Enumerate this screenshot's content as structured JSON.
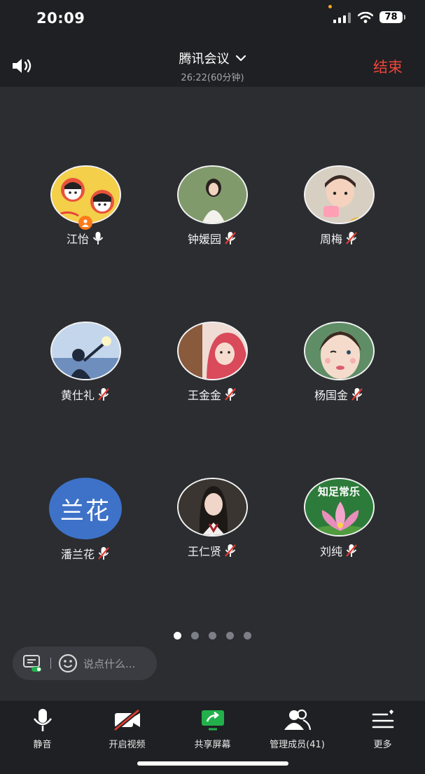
{
  "status_bar": {
    "time": "20:09",
    "battery": "78"
  },
  "header": {
    "title": "腾讯会议",
    "subtitle": "26:22(60分钟)",
    "end_label": "结束"
  },
  "participants": [
    {
      "name": "江怡",
      "mic": "mic-on",
      "host": true,
      "avatar": "cartoon"
    },
    {
      "name": "钟媛园",
      "mic": "mic-off",
      "avatar": "photo"
    },
    {
      "name": "周梅",
      "mic": "mic-off",
      "avatar": "photo"
    },
    {
      "name": "黄仕礼",
      "mic": "mic-off",
      "avatar": "photo"
    },
    {
      "name": "王金金",
      "mic": "mic-off",
      "avatar": "photo"
    },
    {
      "name": "杨国金",
      "mic": "mic-off",
      "avatar": "photo"
    },
    {
      "name": "潘兰花",
      "mic": "mic-off",
      "avatar": "text",
      "avatar_text": "兰花"
    },
    {
      "name": "王仁贤",
      "mic": "mic-off",
      "avatar": "photo"
    },
    {
      "name": "刘纯",
      "mic": "mic-off",
      "avatar": "photo",
      "avatar_text": "知足常乐"
    }
  ],
  "pagination": {
    "pages": 5,
    "current": 1
  },
  "chat": {
    "placeholder": "说点什么..."
  },
  "toolbar": {
    "mute": "静音",
    "video": "开启视频",
    "share": "共享屏幕",
    "members": "管理成员(41)",
    "more": "更多"
  },
  "colors": {
    "end": "#f0453a",
    "share": "#22b04b",
    "avatar_blue": "#3d72c8",
    "host_badge": "#ff7a1a"
  }
}
